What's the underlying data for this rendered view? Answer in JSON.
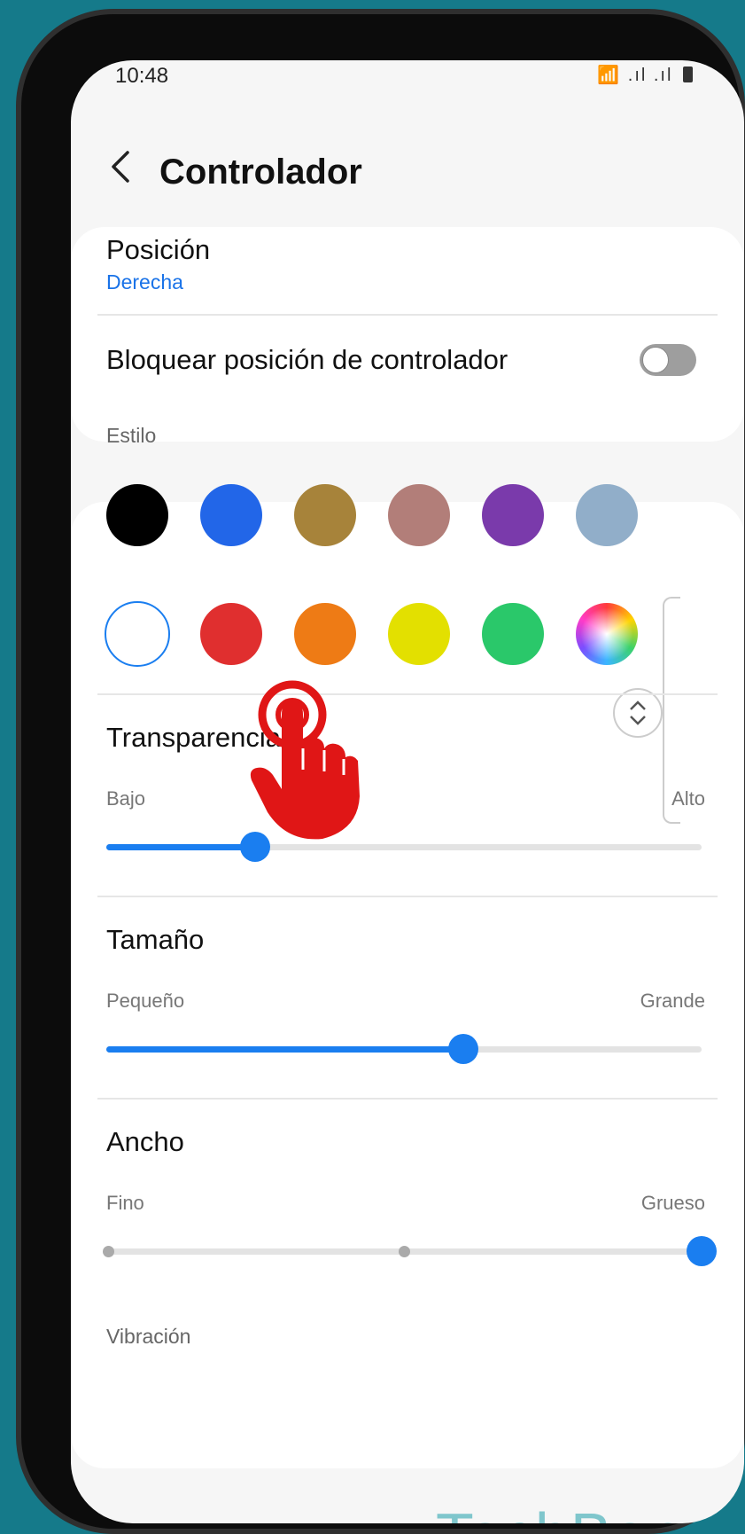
{
  "status_bar": {
    "time": "10:48",
    "icons": "📶 .ıl .ıl"
  },
  "header": {
    "title": "Controlador"
  },
  "position": {
    "label": "Posición",
    "value": "Derecha"
  },
  "lock": {
    "label": "Bloquear posición de controlador",
    "enabled": false
  },
  "style": {
    "section_label": "Estilo",
    "colors_row1": [
      "#000000",
      "#2266e8",
      "#a7833a",
      "#b27e79",
      "#7a3aab",
      "#91aec9"
    ],
    "colors_row2": [
      "#ffffff",
      "#e02f2f",
      "#ee7b15",
      "#e3e000",
      "#2ac86a",
      "rainbow"
    ],
    "selected_color": "#ffffff"
  },
  "transparency": {
    "label": "Transparencia",
    "min_label": "Bajo",
    "max_label": "Alto",
    "level": 0.25
  },
  "size": {
    "label": "Tamaño",
    "min_label": "Pequeño",
    "max_label": "Grande",
    "level": 0.6
  },
  "width": {
    "label": "Ancho",
    "min_label": "Fino",
    "max_label": "Grueso",
    "level": 1.0,
    "steps": 3
  },
  "vibration": {
    "section_label": "Vibración"
  },
  "watermark": "TechBone",
  "icons": [
    "back-icon",
    "wifi-icon",
    "signal-icon",
    "battery-icon",
    "scroll-arrows-icon",
    "tap-hand-icon"
  ]
}
